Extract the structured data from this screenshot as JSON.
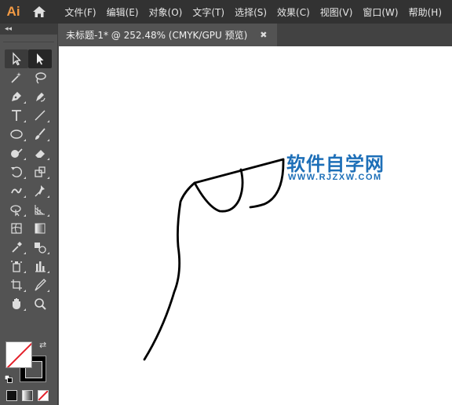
{
  "app": {
    "logo": "Ai"
  },
  "menu": [
    "文件(F)",
    "编辑(E)",
    "对象(O)",
    "文字(T)",
    "选择(S)",
    "效果(C)",
    "视图(V)",
    "窗口(W)",
    "帮助(H)"
  ],
  "toolpanel": {
    "collapse_label": "◂◂"
  },
  "document": {
    "tab_title": "未标题-1* @ 252.48% (CMYK/GPU 预览)",
    "close_glyph": "✖"
  },
  "watermark": {
    "title": "软件自学网",
    "url": "WWW.RJZXW.COM"
  },
  "colors": {
    "accent": "#f29a44",
    "watermark": "#1d6fb8",
    "stroke": "#000000",
    "fill": "none"
  }
}
